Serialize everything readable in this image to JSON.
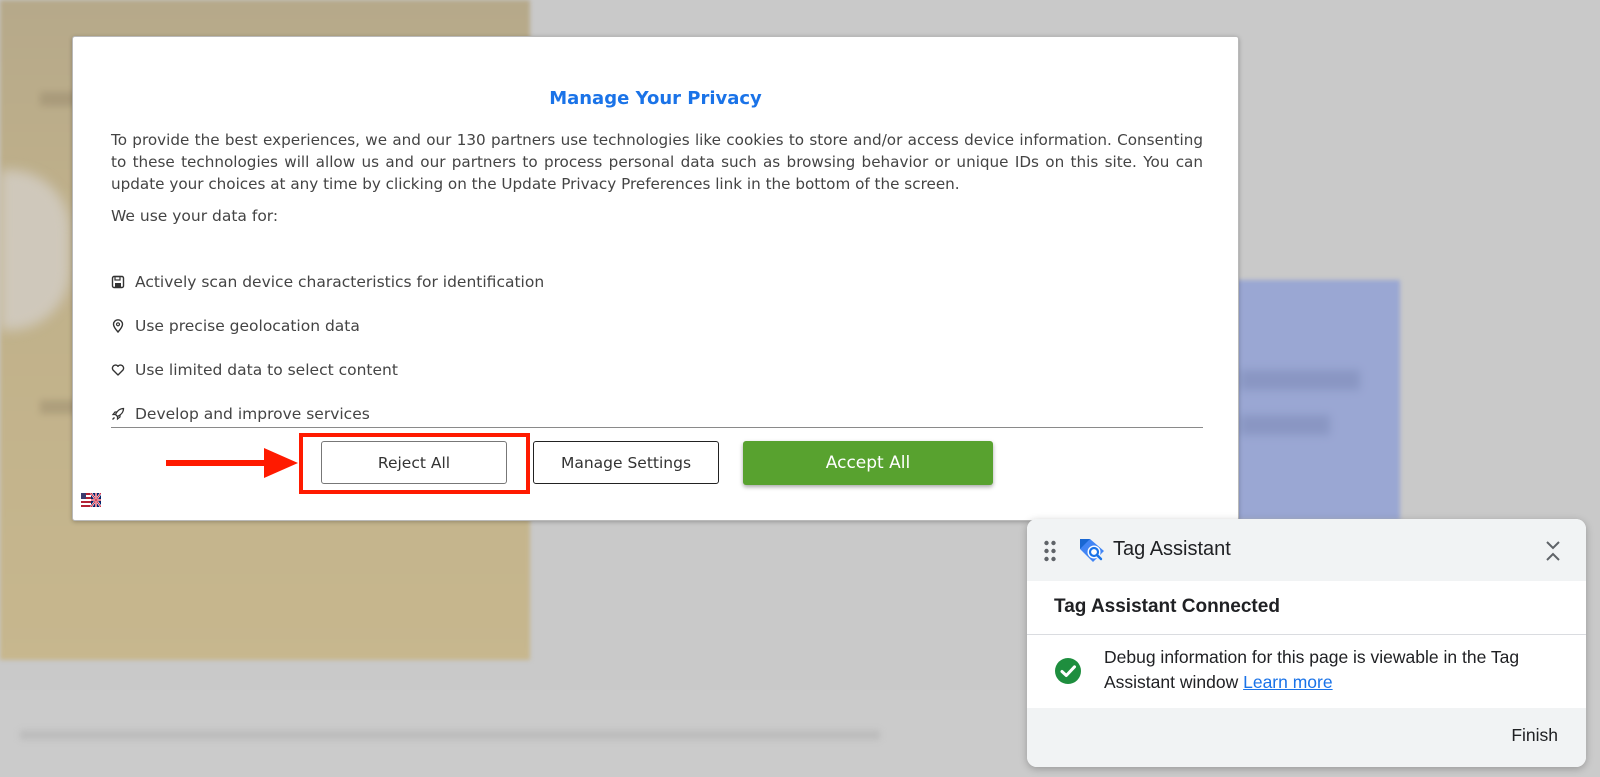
{
  "consent": {
    "title": "Manage Your Privacy",
    "description": "To provide the best experiences, we and our 130 partners use technologies like cookies to store and/or access device information. Consenting to these technologies will allow us and our partners to process personal data such as browsing behavior or unique IDs on this site. You can update your choices at any time by clicking on the Update Privacy Preferences link in the bottom of the screen.",
    "use_label": "We use your data for:",
    "purposes": [
      {
        "icon": "save-icon",
        "label": "Actively scan device characteristics for identification"
      },
      {
        "icon": "location-pin-icon",
        "label": "Use precise geolocation data"
      },
      {
        "icon": "heart-icon",
        "label": "Use limited data to select content"
      },
      {
        "icon": "rocket-icon",
        "label": "Develop and improve services"
      }
    ],
    "buttons": {
      "reject": "Reject All",
      "manage": "Manage Settings",
      "accept": "Accept All"
    },
    "accept_color": "#58a22f",
    "title_color": "#1a73e8",
    "language_flag": "uk-us-flag-icon"
  },
  "annotation": {
    "highlight_color": "#ff1a00",
    "target": "reject-all-button"
  },
  "tag_assistant": {
    "name": "Tag Assistant",
    "status": "Tag Assistant Connected",
    "message": "Debug information for this page is viewable in the Tag Assistant window",
    "link": "Learn more",
    "finish": "Finish",
    "check_color": "#1e8e3e"
  }
}
